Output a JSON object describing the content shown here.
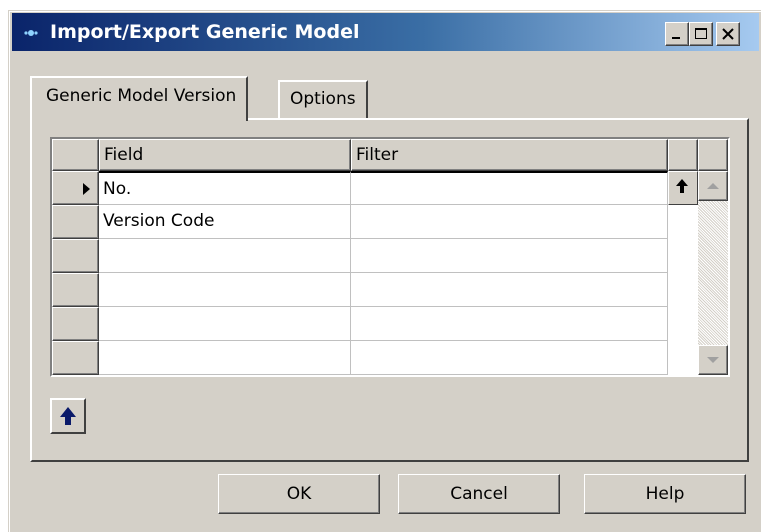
{
  "window": {
    "title": "Import/Export Generic Model",
    "titlebar_colors": [
      "#0a246a",
      "#3a6ea5",
      "#a6caf0"
    ],
    "controls": [
      "minimize-icon",
      "maximize-icon",
      "close-icon"
    ]
  },
  "tabs": [
    {
      "label": "Generic Model Version",
      "active": true
    },
    {
      "label": "Options",
      "active": false
    }
  ],
  "grid": {
    "headers": {
      "field": "Field",
      "filter": "Filter"
    },
    "rows": [
      {
        "field": "No.",
        "filter": "",
        "current": true
      },
      {
        "field": "Version Code",
        "filter": ""
      },
      {
        "field": "",
        "filter": ""
      },
      {
        "field": "",
        "filter": ""
      },
      {
        "field": "",
        "filter": ""
      },
      {
        "field": "",
        "filter": ""
      }
    ]
  },
  "buttons": {
    "ok": "OK",
    "cancel": "Cancel",
    "help": "Help"
  }
}
